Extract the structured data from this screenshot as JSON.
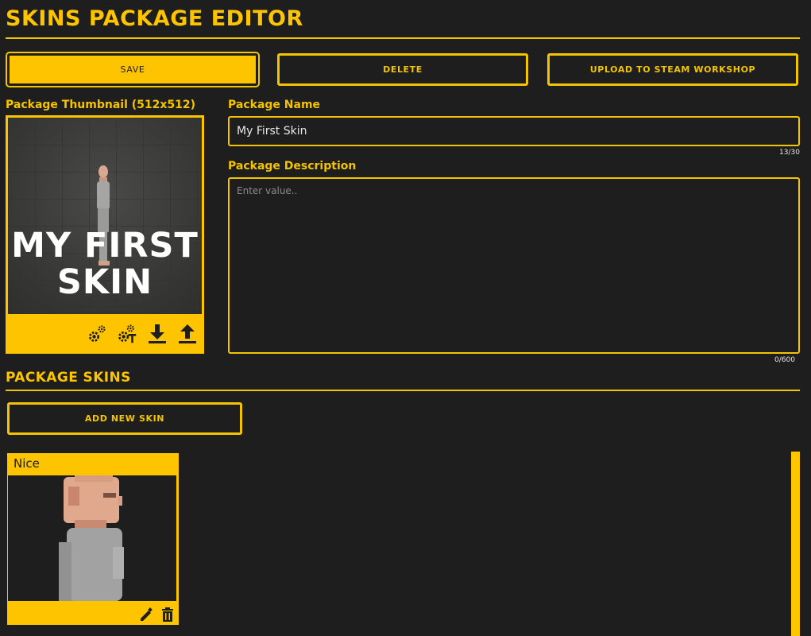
{
  "header": {
    "title": "SKINS PACKAGE EDITOR"
  },
  "toolbar": {
    "save_label": "SAVE",
    "delete_label": "DELETE",
    "upload_label": "UPLOAD TO STEAM WORKSHOP"
  },
  "thumbnail": {
    "label": "Package Thumbnail (512x512)",
    "overlay_line1": "MY FIRST",
    "overlay_line2": "SKIN",
    "tools": [
      "gears-icon",
      "gears-text-icon",
      "download-icon",
      "upload-icon"
    ]
  },
  "package_name": {
    "label": "Package Name",
    "value": "My First Skin",
    "counter": "13/30"
  },
  "package_description": {
    "label": "Package Description",
    "placeholder": "Enter value..",
    "value": "",
    "counter": "0/600"
  },
  "skins": {
    "section_title": "PACKAGE SKINS",
    "add_label": "ADD NEW SKIN",
    "items": [
      {
        "name": "Nice"
      }
    ]
  },
  "colors": {
    "accent": "#ffc400",
    "background": "#1e1e1e",
    "text_light": "#e8e8e8"
  }
}
